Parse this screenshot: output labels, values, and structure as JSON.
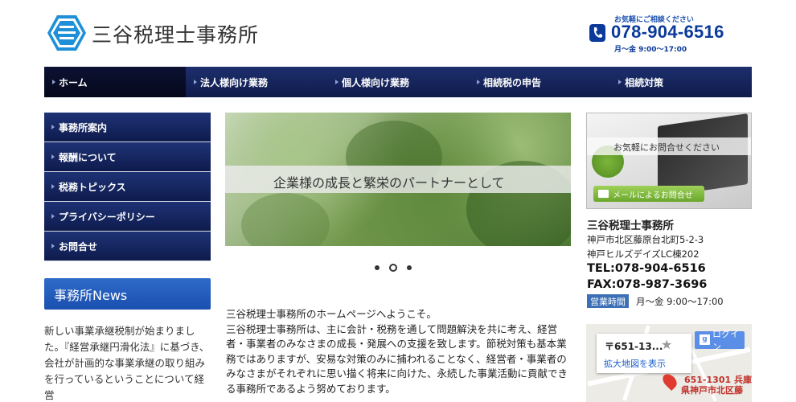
{
  "header": {
    "site_title": "三谷税理士事務所",
    "contact_lead": "お気軽にご相談ください",
    "phone": "078-904-6516",
    "hours": "月〜金 9:00〜17:00"
  },
  "gnav": {
    "items": [
      {
        "label": "ホーム",
        "active": true
      },
      {
        "label": "法人様向け業務"
      },
      {
        "label": "個人様向け業務"
      },
      {
        "label": "相続税の申告"
      },
      {
        "label": "相続対策"
      }
    ]
  },
  "side_menu": {
    "items": [
      {
        "label": "事務所案内"
      },
      {
        "label": "報酬について"
      },
      {
        "label": "税務トピックス"
      },
      {
        "label": "プライバシーポリシー"
      },
      {
        "label": "お問合せ"
      }
    ]
  },
  "news": {
    "heading": "事務所News",
    "body": "新しい事業承継税制が始まりました。『経営承継円滑化法』に基づき、会社が計画的な事業承継の取り組みを行っているということについて経営"
  },
  "slider": {
    "caption": "企業様の成長と繁栄のパートナーとして",
    "dot_count": 3,
    "current_index": 1
  },
  "intro": {
    "line1": "三谷税理士事務所のホームページへようこそ。",
    "body": "三谷税理士事務所は、主に会計・税務を通して問題解決を共に考え、経営者・事業者のみなさまの成長・発展への支援を致します。節税対策も基本業務ではありますが、安易な対策のみに捕われることなく、経営者・事業者のみなさまがそれぞれに思い描く将来に向けた、永続した事業活動に貢献できる事務所であるよう努めております。"
  },
  "mail_banner": {
    "headline": "お気軽にお問合せください",
    "button": "メールによるお問合せ"
  },
  "office": {
    "name": "三谷税理士事務所",
    "address1": "神戸市北区藤原台北町5-2-3",
    "address2": "神戸ヒルズデイズLC棟202",
    "tel": "TEL:078-904-6516",
    "fax": "FAX:078-987-3696",
    "hours_label": "営業時間",
    "hours": "月〜金 9:00〜17:00"
  },
  "map": {
    "card_title": "〒651-13...",
    "card_link": "拡大地図を表示",
    "login": "ログイン",
    "login_icon": "g",
    "label1": "651-1301 兵庫",
    "label2": "県神戸市北区藤"
  },
  "colors": {
    "nav_dark": "#0f1b4a",
    "accent_blue": "#0b3a9a",
    "news_blue": "#1a4fae"
  }
}
